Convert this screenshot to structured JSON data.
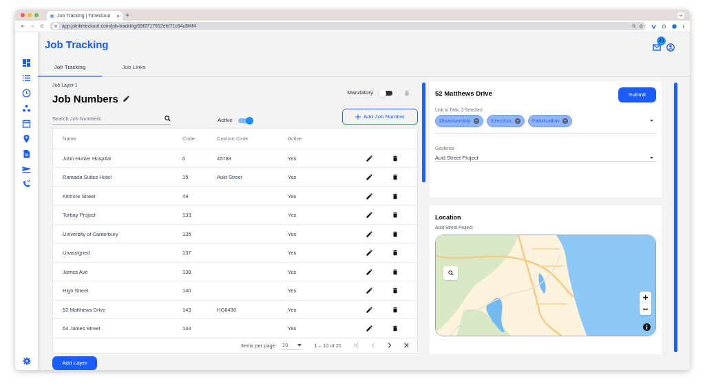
{
  "browser": {
    "tab_title": "Job Tracking | Timecloud",
    "url": "app.jointimecloud.com/job-tracking/65f2717912efd71c64c8f4f4"
  },
  "header": {
    "title": "Job Tracking",
    "mail_badge": "20"
  },
  "tabs": [
    {
      "label": "Job Tracking",
      "selected": true
    },
    {
      "label": "Job Links",
      "selected": false
    }
  ],
  "layer": {
    "caption": "Job Layer 1",
    "title": "Job Numbers",
    "mandatory": {
      "label": "Mandatory",
      "on": false
    },
    "search": {
      "placeholder": "Search Job Numbers"
    },
    "active_filter": {
      "label": "Active",
      "on": true
    },
    "add_button": "Add Job Number"
  },
  "table": {
    "columns": [
      "Name",
      "Code",
      "Custom Code",
      "Active"
    ],
    "rows": [
      {
        "name": "John Hunter Hospital",
        "code": "6",
        "custom_code": "45788",
        "active": "Yes"
      },
      {
        "name": "Ramada Suites Hotel",
        "code": "15",
        "custom_code": "Auld Street",
        "active": "Yes"
      },
      {
        "name": "Kilmore Street",
        "code": "49",
        "active": "Yes"
      },
      {
        "name": "Torbay Project",
        "code": "133",
        "active": "Yes"
      },
      {
        "name": "University of Canterbury",
        "code": "135",
        "active": "Yes"
      },
      {
        "name": "Unassigned",
        "code": "137",
        "active": "Yes"
      },
      {
        "name": "James Ave",
        "code": "138",
        "active": "Yes"
      },
      {
        "name": "High Street",
        "code": "140",
        "active": "Yes"
      },
      {
        "name": "52 Matthews Drive",
        "code": "143",
        "custom_code": "HG8438",
        "active": "Yes"
      },
      {
        "name": "64 James Street",
        "code": "144",
        "active": "Yes"
      }
    ]
  },
  "pagination": {
    "label": "Items per page:",
    "page_size": "10",
    "range": "1 – 10 of 21"
  },
  "add_layer_button": "Add Layer",
  "detail": {
    "title": "52 Matthews Drive",
    "submit": "Submit",
    "tasks": {
      "label": "Link to Task: 3 Selected",
      "chips": [
        "Disassembly",
        "Erection",
        "Fabrication"
      ]
    },
    "geofence": {
      "label": "Geofence",
      "value": "Auld Street Project"
    }
  },
  "location": {
    "title": "Location",
    "subtitle": "Auld Street Project"
  }
}
